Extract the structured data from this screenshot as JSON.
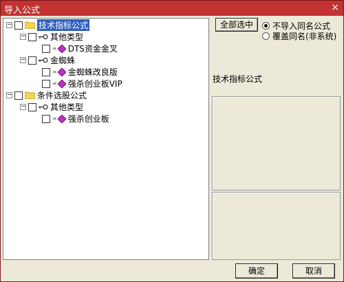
{
  "window": {
    "title": "导入公式",
    "close_glyph": "×"
  },
  "tree": {
    "nodes": [
      {
        "label": "技术指标公式",
        "selected": true
      },
      {
        "label": "其他类型"
      },
      {
        "label": "DTS资金金叉"
      },
      {
        "label": "金蜘蛛"
      },
      {
        "label": "金蜘蛛改良版"
      },
      {
        "label": "强杀创业板VIP"
      },
      {
        "label": "条件选股公式"
      },
      {
        "label": "其他类型"
      },
      {
        "label": "强杀创业板"
      }
    ]
  },
  "actions": {
    "select_all_label": "全部选中"
  },
  "options": {
    "no_import_label": "不导入同名公式",
    "overwrite_label": "覆盖同名(非系统)",
    "selected": "no_import"
  },
  "info": {
    "label": "技术指标公式"
  },
  "footer": {
    "ok_label": "确定",
    "cancel_label": "取消"
  },
  "colors": {
    "titlebar": "#c23232",
    "selection": "#2f5fbf",
    "folder": "#f2d64b",
    "gem": "#c030c0"
  }
}
